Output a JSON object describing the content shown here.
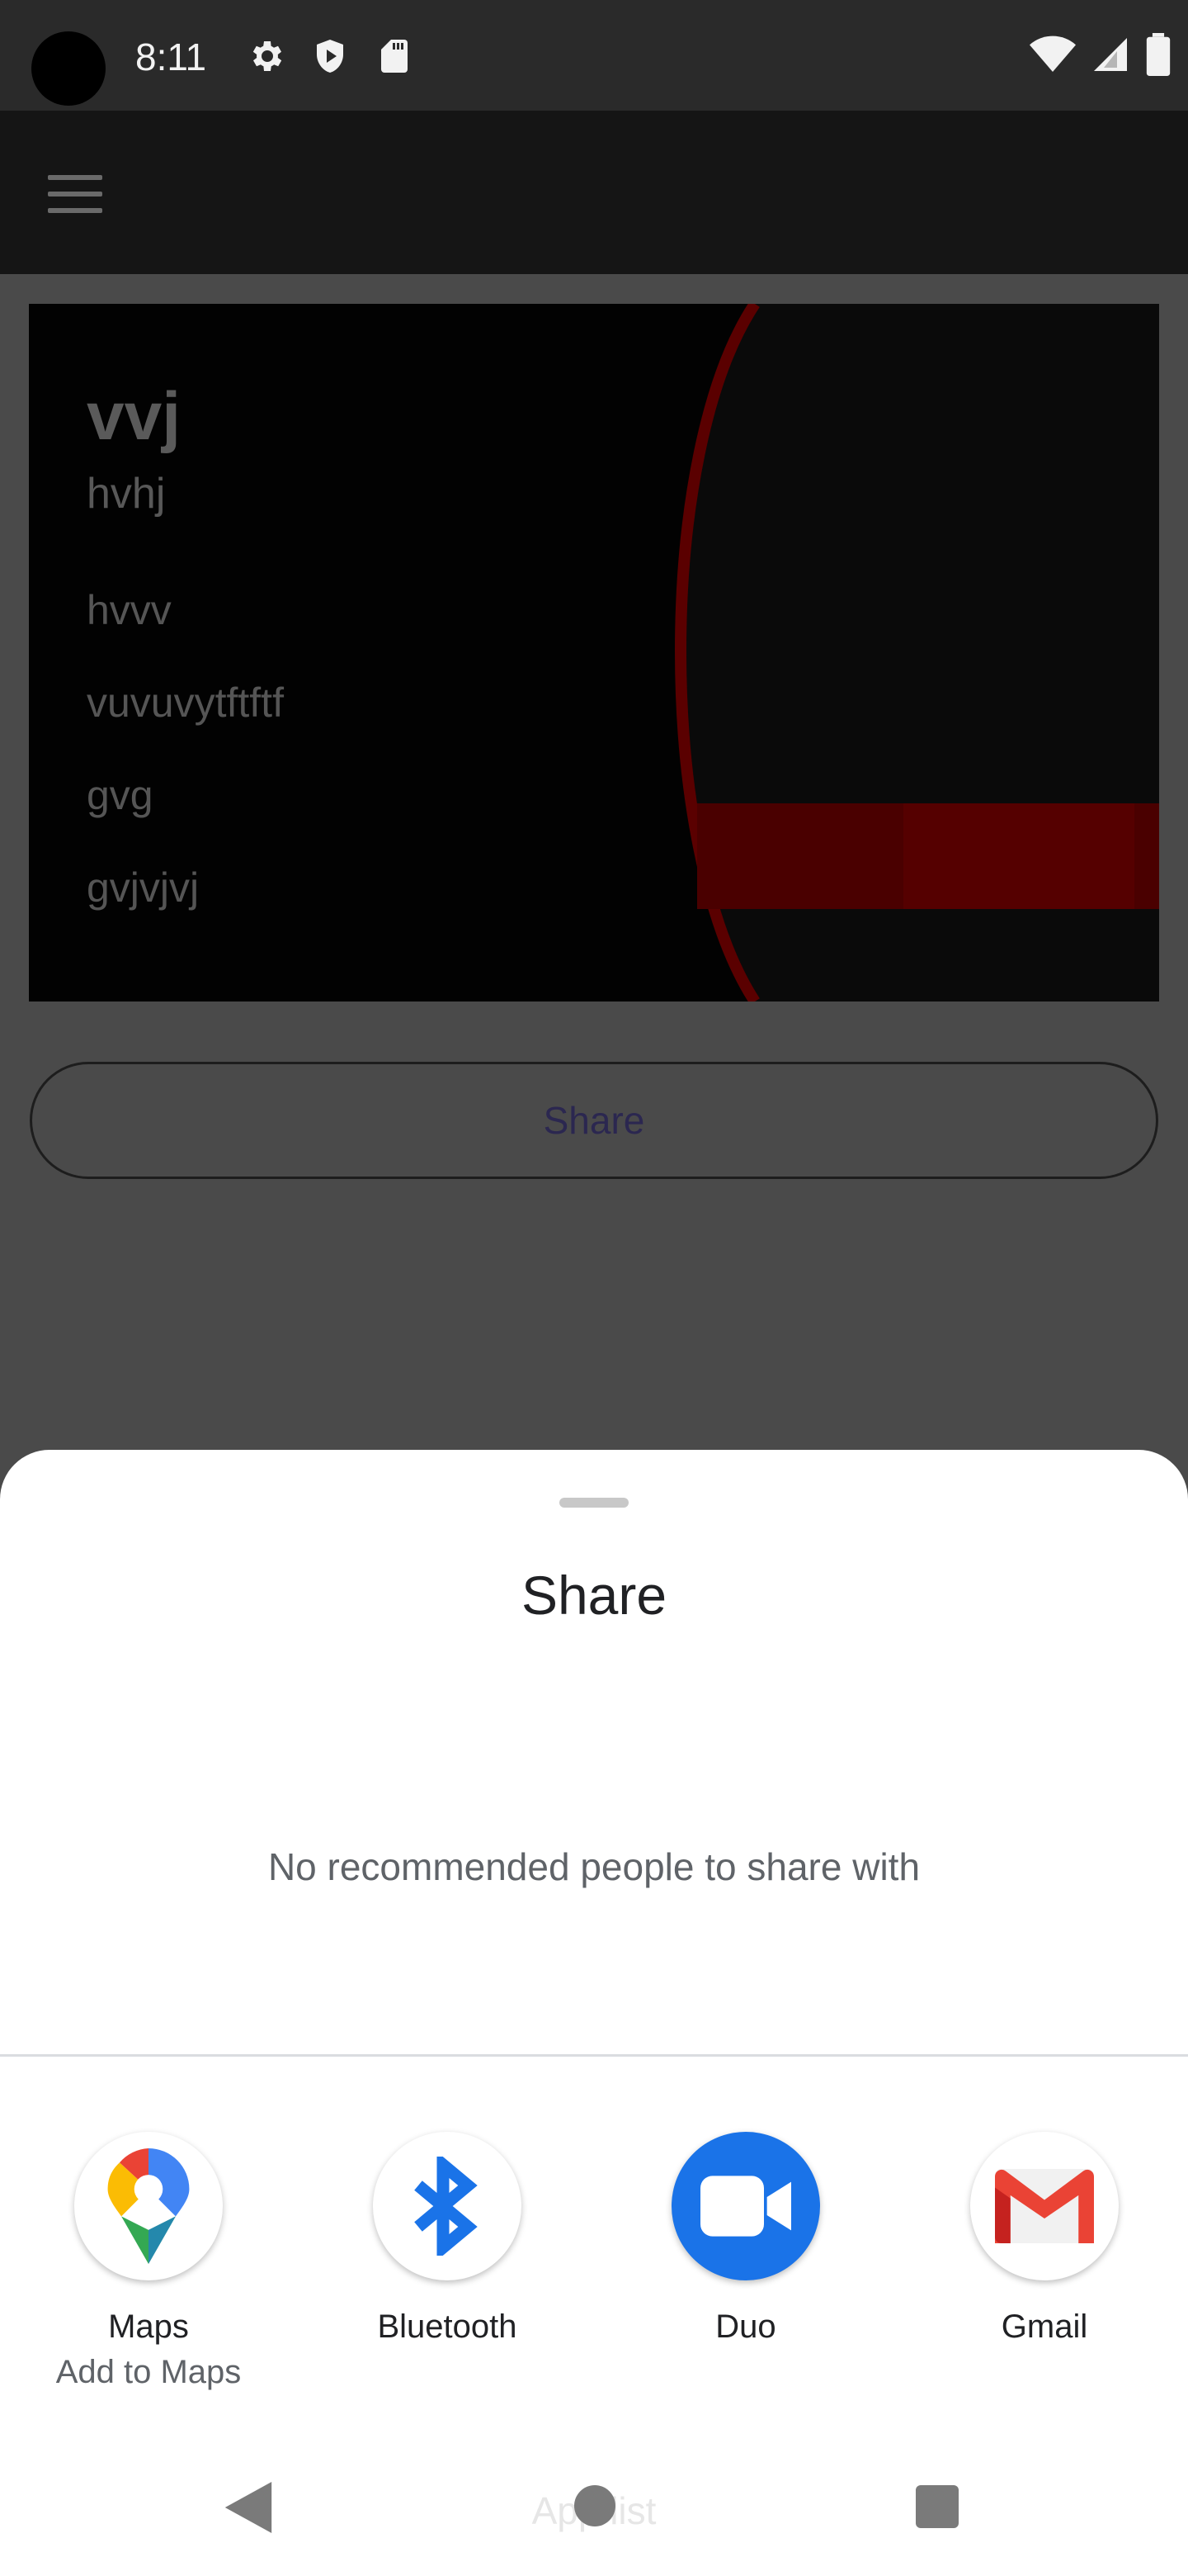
{
  "status_bar": {
    "time": "8:11",
    "left_icons": [
      "gear-icon",
      "shield-icon",
      "sd-card-icon"
    ],
    "right_icons": [
      "wifi-icon",
      "cell-signal-icon",
      "battery-icon"
    ]
  },
  "app_bar": {
    "menu_icon": "hamburger-menu-icon"
  },
  "card": {
    "title": "vvj",
    "subtitle": "hvhj",
    "lines": [
      "hvvv",
      "vuvuvytftftf",
      "gvg",
      "gvjvjvj"
    ]
  },
  "share_button_label": "Share",
  "sheet": {
    "title": "Share",
    "empty_message": "No recommended people to share with",
    "targets": [
      {
        "label": "Maps",
        "sublabel": "Add to Maps",
        "icon": "maps-icon"
      },
      {
        "label": "Bluetooth",
        "sublabel": "",
        "icon": "bluetooth-icon"
      },
      {
        "label": "Duo",
        "sublabel": "",
        "icon": "duo-video-icon"
      },
      {
        "label": "Gmail",
        "sublabel": "",
        "icon": "gmail-icon"
      }
    ]
  },
  "nav": {
    "ghost_text": "App list"
  },
  "colors": {
    "accent_blue": "#1a73e8",
    "duo_blue": "#1a73e8",
    "card_red": "#8b0000",
    "sheet_bg": "#ffffff"
  }
}
